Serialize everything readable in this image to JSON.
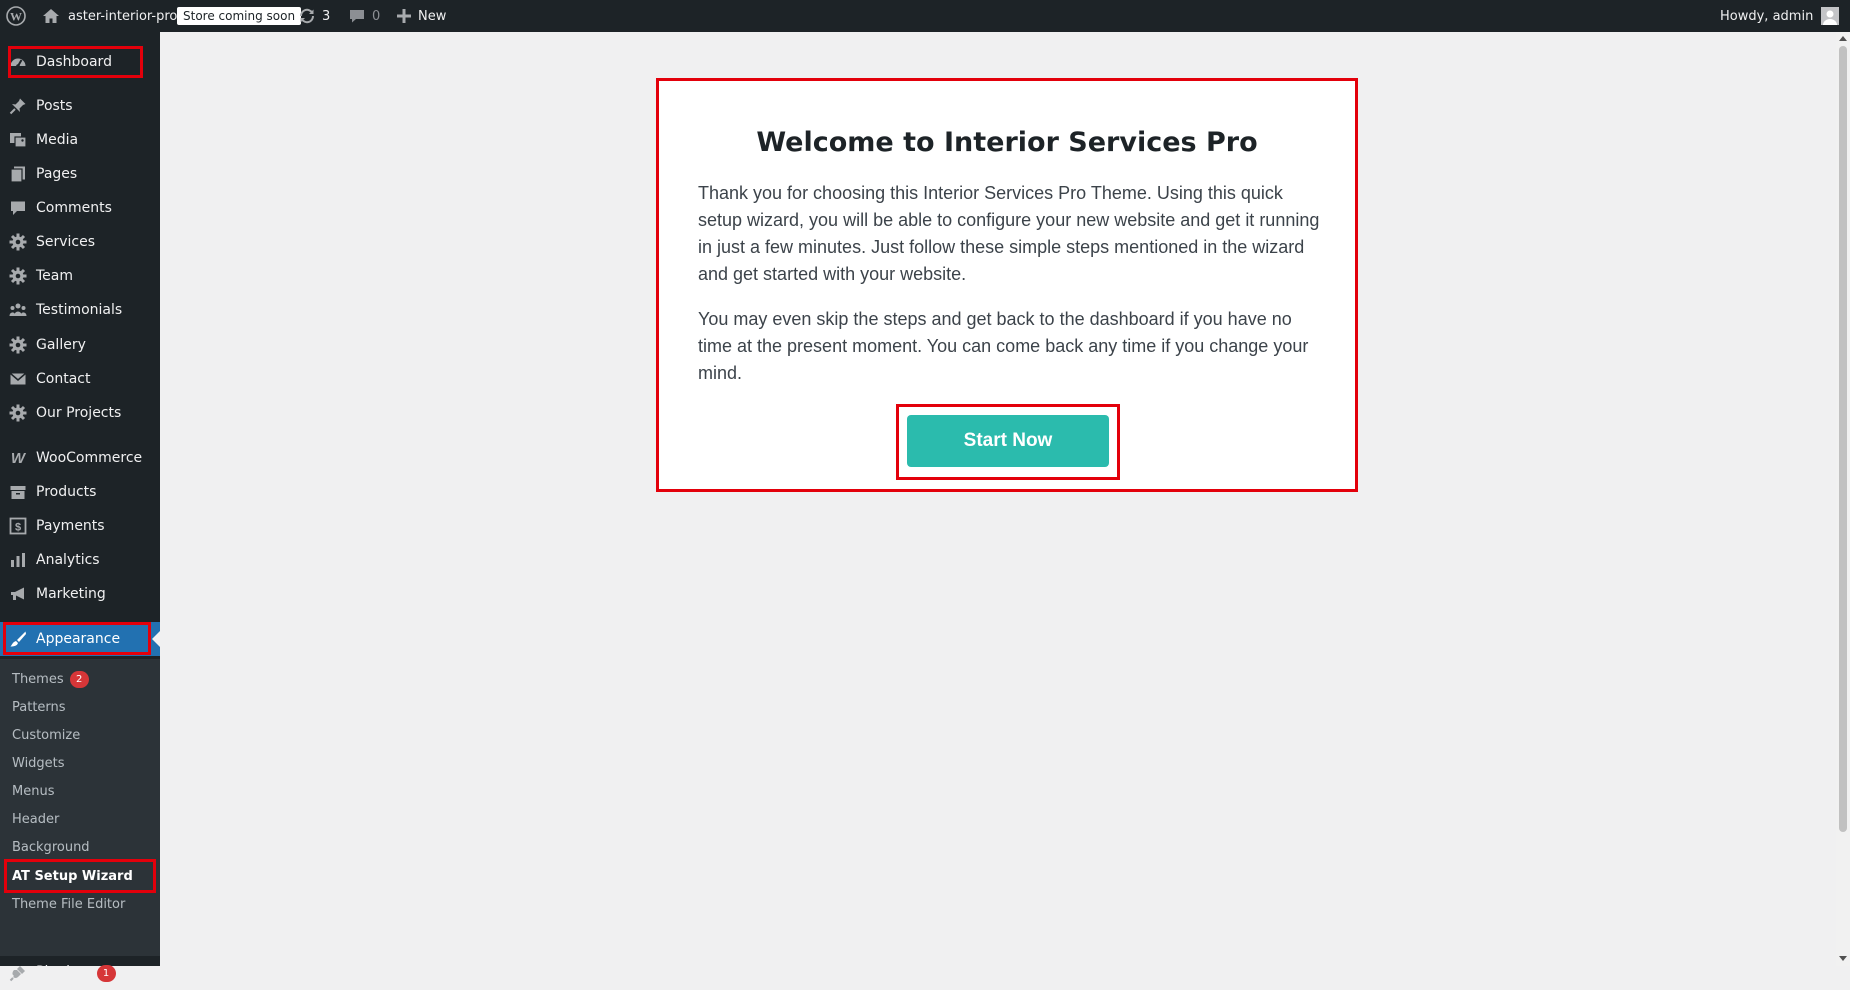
{
  "admin_bar": {
    "site_name": "aster-interior-pro",
    "store_badge": "Store coming soon",
    "updates_count": "3",
    "comments_count": "0",
    "new_label": "New",
    "greeting": "Howdy, admin"
  },
  "sidebar": {
    "items": [
      {
        "label": "Dashboard",
        "icon": "dashboard-icon"
      },
      {
        "label": "Posts",
        "icon": "pushpin-icon"
      },
      {
        "label": "Media",
        "icon": "media-icon"
      },
      {
        "label": "Pages",
        "icon": "pages-icon"
      },
      {
        "label": "Comments",
        "icon": "comment-icon"
      },
      {
        "label": "Services",
        "icon": "gear-icon"
      },
      {
        "label": "Team",
        "icon": "gear-icon"
      },
      {
        "label": "Testimonials",
        "icon": "groups-icon"
      },
      {
        "label": "Gallery",
        "icon": "gear-icon"
      },
      {
        "label": "Contact",
        "icon": "envelope-icon"
      },
      {
        "label": "Our Projects",
        "icon": "gear-icon"
      },
      {
        "label": "WooCommerce",
        "icon": "woo-icon"
      },
      {
        "label": "Products",
        "icon": "archive-icon"
      },
      {
        "label": "Payments",
        "icon": "dollar-icon"
      },
      {
        "label": "Analytics",
        "icon": "bar-chart-icon"
      },
      {
        "label": "Marketing",
        "icon": "megaphone-icon"
      },
      {
        "label": "Appearance",
        "icon": "paintbrush-icon"
      },
      {
        "label": "Plugins",
        "icon": "plug-icon"
      }
    ],
    "submenu": [
      {
        "label": "Themes",
        "badge": "2"
      },
      {
        "label": "Patterns"
      },
      {
        "label": "Customize"
      },
      {
        "label": "Widgets"
      },
      {
        "label": "Menus"
      },
      {
        "label": "Header"
      },
      {
        "label": "Background"
      },
      {
        "label": "AT Setup Wizard"
      },
      {
        "label": "Theme File Editor"
      }
    ],
    "plugins_badge": "1"
  },
  "wizard": {
    "title": "Welcome to Interior Services Pro",
    "paragraph1": "Thank you for choosing this Interior Services Pro Theme. Using this quick setup wizard, you will be able to configure your new website and get it running in just a few minutes. Just follow these simple steps mentioned in the wizard and get started with your website.",
    "paragraph2": "You may even skip the steps and get back to the dashboard if you have no time at the present moment. You can come back any time if you change your mind.",
    "start_button": "Start Now"
  },
  "colors": {
    "admin_bg": "#1d2327",
    "submenu_bg": "#2c3338",
    "accent": "#2271b1",
    "highlight": "#e3000b",
    "button": "#2bbbad",
    "badge": "#d63638"
  }
}
